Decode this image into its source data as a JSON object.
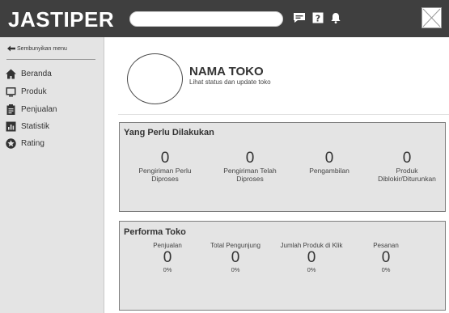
{
  "header": {
    "brand": "JASTIPER",
    "search_placeholder": "",
    "icons": [
      "chat-icon",
      "help-icon",
      "bell-icon",
      "close-icon"
    ]
  },
  "sidebar": {
    "hide_menu_label": "Sembunyikan menu",
    "items": [
      {
        "label": "Beranda",
        "icon": "home-icon"
      },
      {
        "label": "Produk",
        "icon": "product-icon"
      },
      {
        "label": "Penjualan",
        "icon": "clipboard-icon"
      },
      {
        "label": "Statistik",
        "icon": "chart-icon"
      },
      {
        "label": "Rating",
        "icon": "star-icon"
      }
    ]
  },
  "profile": {
    "name": "NAMA TOKO",
    "subtitle": "Lihat status dan update toko"
  },
  "todo": {
    "title": "Yang Perlu Dilakukan",
    "items": [
      {
        "value": "0",
        "label_line1": "Pengiriman Perlu",
        "label_line2": "Diproses"
      },
      {
        "value": "0",
        "label_line1": "Pengiriman Telah",
        "label_line2": "Diproses"
      },
      {
        "value": "0",
        "label_line1": "Pengambilan",
        "label_line2": ""
      },
      {
        "value": "0",
        "label_line1": "Produk",
        "label_line2": "Diblokir/Diturunkan"
      }
    ]
  },
  "performance": {
    "title": "Performa Toko",
    "items": [
      {
        "label": "Penjualan",
        "value": "0",
        "percent": "0%"
      },
      {
        "label": "Total Pengunjung",
        "value": "0",
        "percent": "0%"
      },
      {
        "label": "Jumlah Produk di Klik",
        "value": "0",
        "percent": "0%"
      },
      {
        "label": "Pesanan",
        "value": "0",
        "percent": "0%"
      }
    ]
  }
}
